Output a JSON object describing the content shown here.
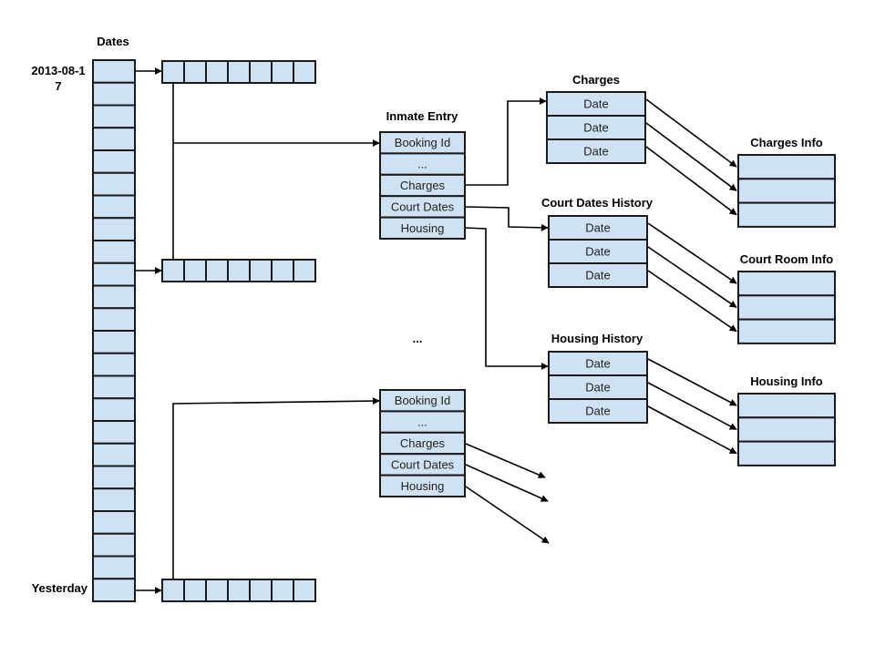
{
  "colors": {
    "cell_fill": "#cfe2f3",
    "stroke": "#1a1a1a",
    "text": "#000000"
  },
  "dates_column": {
    "title": "Dates",
    "first_label": "2013-08-1\n7",
    "first_label_lines": [
      "2013-08-1",
      "7"
    ],
    "last_label": "Yesterday",
    "cell_count": 24
  },
  "entry_rows": [
    {
      "name": "first-day-row",
      "cell_count": 7
    },
    {
      "name": "middle-day-row",
      "cell_count": 7
    },
    {
      "name": "yesterday-row",
      "cell_count": 7
    }
  ],
  "inmate_entry": {
    "title": "Inmate Entry",
    "fields": [
      "Booking Id",
      "...",
      "Charges",
      "Court Dates",
      "Housing"
    ]
  },
  "inmate_entry_2": {
    "fields": [
      "Booking Id",
      "...",
      "Charges",
      "Court Dates",
      "Housing"
    ]
  },
  "ellipsis": "...",
  "history_tables": [
    {
      "title": "Charges",
      "rows": [
        "Date",
        "Date",
        "Date"
      ]
    },
    {
      "title": "Court Dates History",
      "rows": [
        "Date",
        "Date",
        "Date"
      ]
    },
    {
      "title": "Housing History",
      "rows": [
        "Date",
        "Date",
        "Date"
      ]
    }
  ],
  "info_tables": [
    {
      "title": "Charges Info",
      "row_count": 3
    },
    {
      "title": "Court Room Info",
      "row_count": 3
    },
    {
      "title": "Housing Info",
      "row_count": 3
    }
  ]
}
